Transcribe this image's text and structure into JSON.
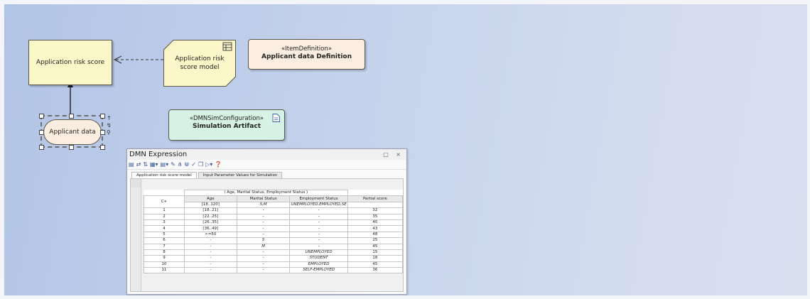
{
  "diagram": {
    "decision_label": "Application risk score",
    "bkm_label": "Application risk score model",
    "item_definition": {
      "stereotype": "«ItemDefinition»",
      "name": "Applicant data Definition"
    },
    "sim_config": {
      "stereotype": "«DMNSimConfiguration»",
      "name": "Simulation Artifact"
    },
    "input_data_label": "Applicant data"
  },
  "dmn_window": {
    "title": "DMN Expression",
    "window_buttons": "□ ×",
    "toolbar_icons": [
      "save-icon",
      "shuffle-icon",
      "sort-icon",
      "insert-column-icon",
      "insert-row-icon",
      "edit-icon",
      "split-icon",
      "merge-icon",
      "validate-icon",
      "copy-icon",
      "run-icon",
      "help-icon"
    ],
    "tabs": [
      "Application risk score model",
      "Input Parameter Values for Simulation"
    ],
    "table": {
      "input_header": "( Age, Marital Status, Employment Status )",
      "hit_policy": "C+",
      "columns": [
        "Age",
        "Marital Status",
        "Employment Status",
        "Partial score"
      ],
      "allowed_values": [
        "[18..120]",
        "S,M",
        "UNEMPLOYED,EMPLOYED,SE",
        ""
      ],
      "rows": [
        [
          "1",
          "[18..21]",
          "-",
          "-",
          "32"
        ],
        [
          "2",
          "[22..25]",
          "-",
          "-",
          "35"
        ],
        [
          "3",
          "[26..35]",
          "-",
          "-",
          "40"
        ],
        [
          "4",
          "[36..49]",
          "-",
          "-",
          "43"
        ],
        [
          "5",
          ">=50",
          "-",
          "-",
          "48"
        ],
        [
          "6",
          "-",
          "S",
          "-",
          "25"
        ],
        [
          "7",
          "-",
          "M",
          "-",
          "45"
        ],
        [
          "8",
          "-",
          "-",
          "UNEMPLOYED",
          "15"
        ],
        [
          "9",
          "-",
          "-",
          "STUDENT",
          "18"
        ],
        [
          "10",
          "-",
          "-",
          "EMPLOYED",
          "45"
        ],
        [
          "11",
          "-",
          "-",
          "SELF-EMPLOYED",
          "36"
        ]
      ]
    }
  }
}
